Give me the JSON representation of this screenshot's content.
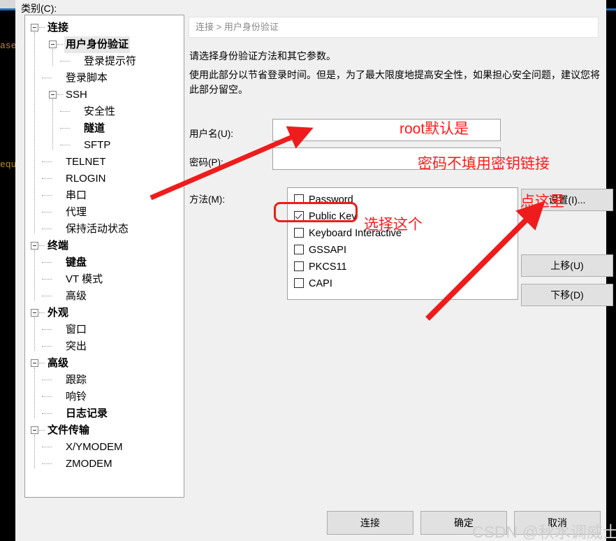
{
  "background": {
    "terminal_left_line1": "ase",
    "terminal_left_line2": "equ"
  },
  "dialog": {
    "category_label": "类别(C):",
    "breadcrumb": "连接 > 用户身份验证",
    "description_line1": "请选择身份验证方法和其它参数。",
    "description_line2": "使用此部分以节省登录时间。但是，为了最大限度地提高安全性，如果担心安全问题，建议您将此部分留空。"
  },
  "tree": {
    "items": [
      {
        "label": "连接",
        "depth": 0,
        "expander": true,
        "bold": true,
        "selected": false
      },
      {
        "label": "用户身份验证",
        "depth": 1,
        "expander": true,
        "bold": true,
        "selected": true
      },
      {
        "label": "登录提示符",
        "depth": 2,
        "expander": false,
        "bold": false,
        "selected": false
      },
      {
        "label": "登录脚本",
        "depth": 1,
        "expander": false,
        "bold": false,
        "selected": false
      },
      {
        "label": "SSH",
        "depth": 1,
        "expander": true,
        "bold": false,
        "selected": false
      },
      {
        "label": "安全性",
        "depth": 2,
        "expander": false,
        "bold": false,
        "selected": false
      },
      {
        "label": "隧道",
        "depth": 2,
        "expander": false,
        "bold": true,
        "selected": false
      },
      {
        "label": "SFTP",
        "depth": 2,
        "expander": false,
        "bold": false,
        "selected": false
      },
      {
        "label": "TELNET",
        "depth": 1,
        "expander": false,
        "bold": false,
        "selected": false
      },
      {
        "label": "RLOGIN",
        "depth": 1,
        "expander": false,
        "bold": false,
        "selected": false
      },
      {
        "label": "串口",
        "depth": 1,
        "expander": false,
        "bold": false,
        "selected": false
      },
      {
        "label": "代理",
        "depth": 1,
        "expander": false,
        "bold": false,
        "selected": false
      },
      {
        "label": "保持活动状态",
        "depth": 1,
        "expander": false,
        "bold": false,
        "selected": false
      },
      {
        "label": "终端",
        "depth": 0,
        "expander": true,
        "bold": true,
        "selected": false
      },
      {
        "label": "键盘",
        "depth": 1,
        "expander": false,
        "bold": true,
        "selected": false
      },
      {
        "label": "VT 模式",
        "depth": 1,
        "expander": false,
        "bold": false,
        "selected": false
      },
      {
        "label": "高级",
        "depth": 1,
        "expander": false,
        "bold": false,
        "selected": false
      },
      {
        "label": "外观",
        "depth": 0,
        "expander": true,
        "bold": true,
        "selected": false
      },
      {
        "label": "窗口",
        "depth": 1,
        "expander": false,
        "bold": false,
        "selected": false
      },
      {
        "label": "突出",
        "depth": 1,
        "expander": false,
        "bold": false,
        "selected": false
      },
      {
        "label": "高级",
        "depth": 0,
        "expander": true,
        "bold": true,
        "selected": false
      },
      {
        "label": "跟踪",
        "depth": 1,
        "expander": false,
        "bold": false,
        "selected": false
      },
      {
        "label": "响铃",
        "depth": 1,
        "expander": false,
        "bold": false,
        "selected": false
      },
      {
        "label": "日志记录",
        "depth": 1,
        "expander": false,
        "bold": true,
        "selected": false
      },
      {
        "label": "文件传输",
        "depth": 0,
        "expander": true,
        "bold": true,
        "selected": false
      },
      {
        "label": "X/YMODEM",
        "depth": 1,
        "expander": false,
        "bold": false,
        "selected": false
      },
      {
        "label": "ZMODEM",
        "depth": 1,
        "expander": false,
        "bold": false,
        "selected": false
      }
    ]
  },
  "form": {
    "username_label": "用户名(U):",
    "username_value": "",
    "password_label": "密码(P):",
    "password_value": "",
    "method_label": "方法(M):",
    "methods": [
      {
        "label": "Password",
        "checked": false
      },
      {
        "label": "Public Key",
        "checked": true
      },
      {
        "label": "Keyboard Interactive",
        "checked": false
      },
      {
        "label": "GSSAPI",
        "checked": false
      },
      {
        "label": "PKCS11",
        "checked": false
      },
      {
        "label": "CAPI",
        "checked": false
      }
    ]
  },
  "side_buttons": {
    "properties": "设置(I)...",
    "move_up": "上移(U)",
    "move_down": "下移(D)"
  },
  "bottom_buttons": {
    "connect": "连接",
    "ok": "确定",
    "cancel": "取消"
  },
  "annotations": {
    "username_note": "root默认是",
    "password_note": "密码不填用密钥链接",
    "method_note": "选择这个",
    "properties_note": "点这里",
    "arrow_color": "#ee1c1c",
    "highlight_color": "#ee1c1c"
  },
  "watermark": {
    "text": "CSDN  @秋水调威士忌"
  }
}
